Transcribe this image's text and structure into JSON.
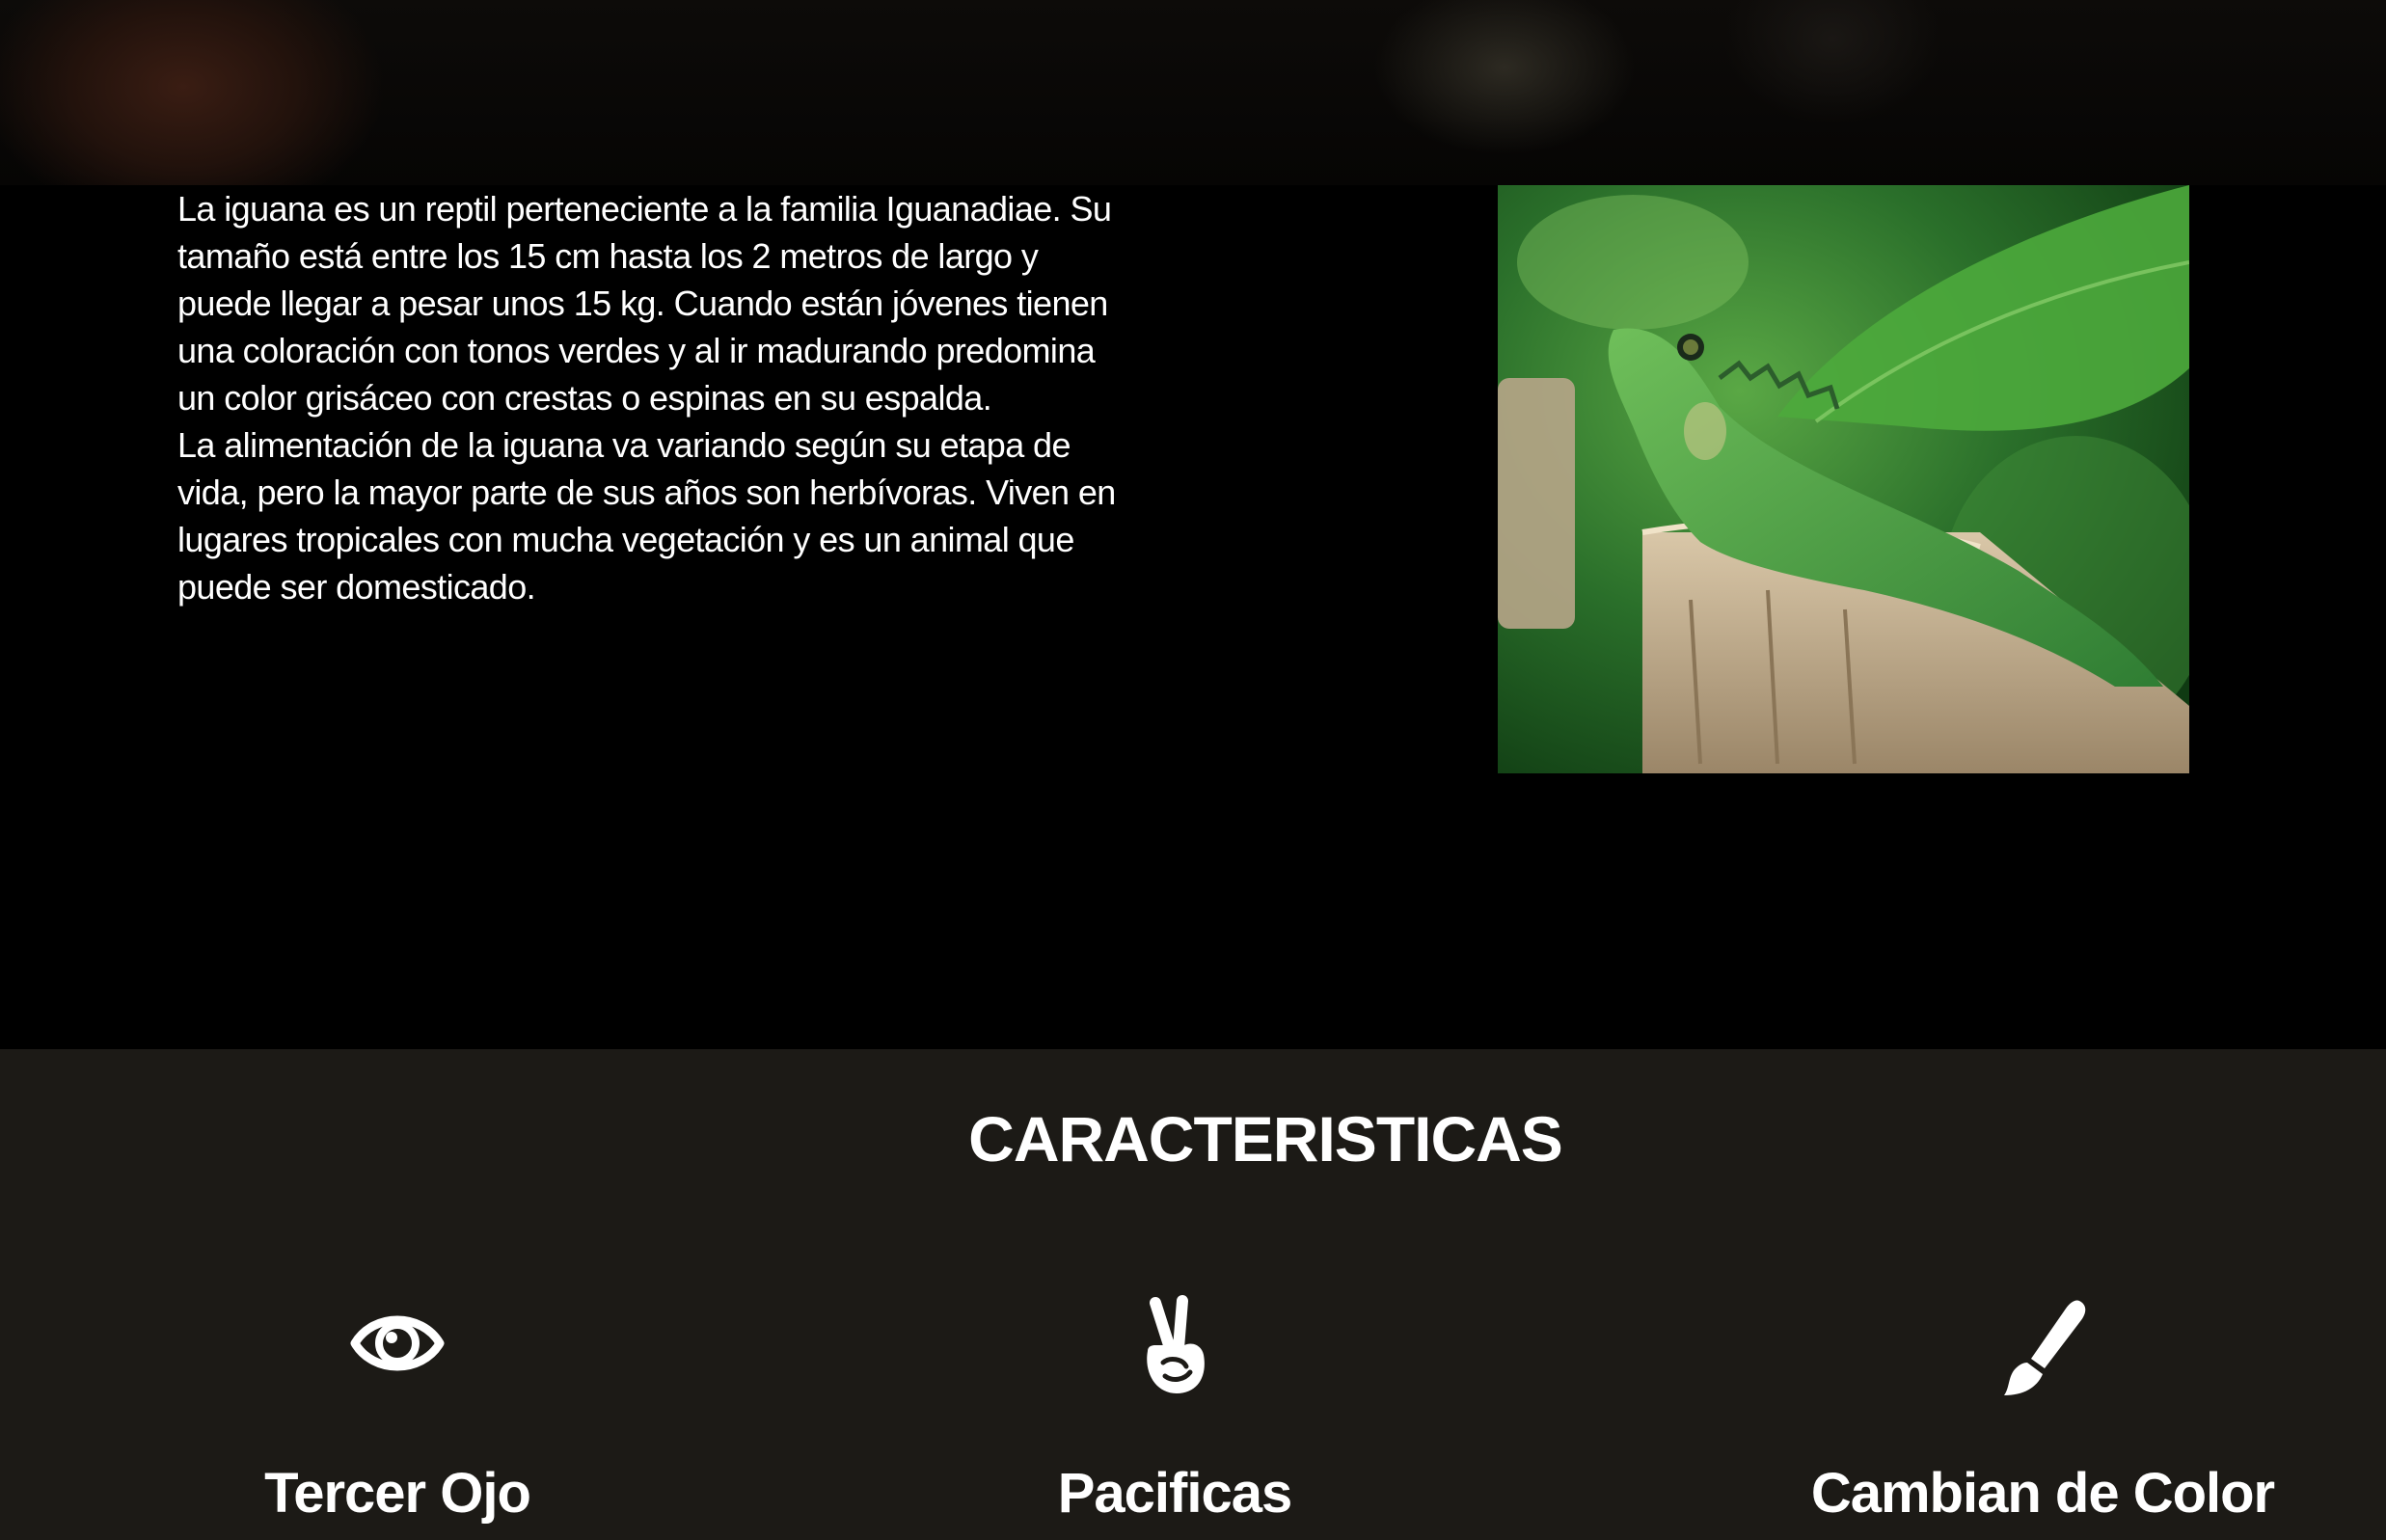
{
  "intro": {
    "paragraph_1": "La iguana es un reptil perteneciente a la familia Iguanadiae. Su tamaño está entre los 15 cm hasta los 2 metros de largo y puede llegar a pesar unos 15 kg. Cuando están jóvenes tienen una coloración con tonos verdes y al ir madurando predomina un color grisáceo con crestas o espinas en su espalda.",
    "paragraph_2": "La alimentación de la iguana va variando según su etapa de vida, pero la mayor parte de sus años son herbívoras. Viven en lugares tropicales con mucha vegetación y es un animal que puede ser domesticado."
  },
  "features": {
    "title": "CARACTERISTICAS",
    "items": [
      {
        "icon": "eye-icon",
        "label": "Tercer Ojo"
      },
      {
        "icon": "peace-hand-icon",
        "label": "Pacificas"
      },
      {
        "icon": "paintbrush-icon",
        "label": "Cambian de Color"
      }
    ]
  },
  "colors": {
    "background": "#000000",
    "features_background": "#1c1a16",
    "text": "#ffffff"
  }
}
